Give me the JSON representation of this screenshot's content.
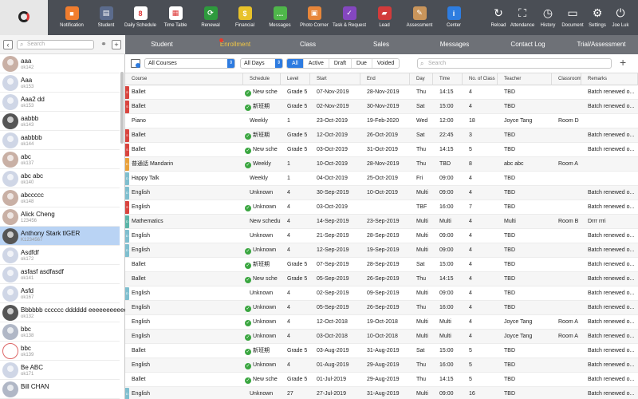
{
  "toolbar": [
    {
      "name": "notification",
      "label": "Notification",
      "color": "#f07d2e",
      "glyph": "■"
    },
    {
      "name": "student",
      "label": "Student",
      "color": "#5b6b8c",
      "glyph": "▤"
    },
    {
      "name": "daily-schedule",
      "label": "Daily Schedule",
      "color": "#ffffff",
      "glyph": "8"
    },
    {
      "name": "time-table",
      "label": "Time Table",
      "color": "#ffffff",
      "glyph": "▦"
    },
    {
      "name": "renewal",
      "label": "Renewal",
      "color": "#2e9a3d",
      "glyph": "⟳"
    },
    {
      "name": "financial",
      "label": "Financial",
      "color": "#e8c22a",
      "glyph": "$"
    },
    {
      "name": "messages",
      "label": "Messages",
      "color": "#4fb64a",
      "glyph": "…"
    },
    {
      "name": "photo-corner",
      "label": "Photo Corner",
      "color": "#e7863a",
      "glyph": "▣"
    },
    {
      "name": "task-request",
      "label": "Task & Request",
      "color": "#8447c0",
      "glyph": "✓"
    },
    {
      "name": "lead",
      "label": "Lead",
      "color": "#d23b3b",
      "glyph": "▰"
    },
    {
      "name": "assessment",
      "label": "Assessment",
      "color": "#c9955b",
      "glyph": "✎"
    },
    {
      "name": "center",
      "label": "Center",
      "color": "#2e7de0",
      "glyph": "i"
    },
    {
      "name": "reload",
      "label": "Reload",
      "color": "",
      "glyph": "↻"
    },
    {
      "name": "attendance",
      "label": "Attendance",
      "color": "",
      "glyph": "⛶"
    },
    {
      "name": "history",
      "label": "History",
      "color": "",
      "glyph": "◷"
    },
    {
      "name": "document",
      "label": "Document",
      "color": "",
      "glyph": "▭"
    },
    {
      "name": "settings",
      "label": "Settings",
      "color": "",
      "glyph": "⚙"
    },
    {
      "name": "user",
      "label": "Joe Luk",
      "color": "",
      "glyph": "⏻"
    }
  ],
  "left": {
    "search_placeholder": "Search",
    "students": [
      {
        "name": "aaa",
        "id": "ok142",
        "av": "p"
      },
      {
        "name": "Aaa",
        "id": "ok153",
        "av": ""
      },
      {
        "name": "Aaa2 dd",
        "id": "ok153",
        "av": ""
      },
      {
        "name": "aabbb",
        "id": "ok143",
        "av": "d"
      },
      {
        "name": "aabbbb",
        "id": "ok144",
        "av": ""
      },
      {
        "name": "abc",
        "id": "ok137",
        "av": "p"
      },
      {
        "name": "abc abc",
        "id": "ok140",
        "av": ""
      },
      {
        "name": "abccccc",
        "id": "ok148",
        "av": "p"
      },
      {
        "name": "Alick Cheng",
        "id": "123456",
        "av": "p"
      },
      {
        "name": "Anthony Stark tIGER",
        "id": "K1234567",
        "av": "d",
        "selected": true
      },
      {
        "name": "Asdfdf",
        "id": "ok172",
        "av": ""
      },
      {
        "name": "asfasf asdfasdf",
        "id": "ok141",
        "av": ""
      },
      {
        "name": "Asfd",
        "id": "ok167",
        "av": ""
      },
      {
        "name": "Bbbbbb cccccc dddddd eeeeeeeeeee",
        "id": "ok132",
        "av": "d"
      },
      {
        "name": "bbc",
        "id": "ok138",
        "av": "g"
      },
      {
        "name": "bbc",
        "id": "ok139",
        "av": "r"
      },
      {
        "name": "Be ABC",
        "id": "ok171",
        "av": ""
      },
      {
        "name": "Bill CHAN",
        "id": "",
        "av": "g"
      }
    ]
  },
  "tabs": [
    {
      "label": "Student",
      "active": false
    },
    {
      "label": "Enrollment",
      "active": true
    },
    {
      "label": "Class",
      "active": false
    },
    {
      "label": "Sales",
      "active": false
    },
    {
      "label": "Messages",
      "active": false
    },
    {
      "label": "Contact Log",
      "active": false
    },
    {
      "label": "Trial/Assessment",
      "active": false
    }
  ],
  "filters": {
    "courses": "All Courses",
    "days": "All Days",
    "segments": [
      "All",
      "Active",
      "Draft",
      "Due",
      "Voided"
    ],
    "active_segment": "All",
    "search_placeholder": "Search"
  },
  "table": {
    "columns": [
      "Course",
      "Schedule",
      "Level",
      "Start",
      "End",
      "Day",
      "Time",
      "No. of Class",
      "Teacher",
      "Classroom",
      "Remarks"
    ],
    "rows": [
      {
        "tag": "#d9453f",
        "tagtext": "S",
        "course": "Ballet",
        "schedule": "New sche",
        "chk": true,
        "level": "Grade 5",
        "start": "07-Nov-2019",
        "end": "28-Nov-2019",
        "day": "Thu",
        "time": "14:15",
        "n": "4",
        "teacher": "TBD",
        "room": "",
        "remarks": "Batch renewed o..."
      },
      {
        "tag": "#d9453f",
        "tagtext": "S",
        "course": "Ballet",
        "schedule": "新班期",
        "chk": true,
        "level": "Grade 5",
        "start": "02-Nov-2019",
        "end": "30-Nov-2019",
        "day": "Sat",
        "time": "15:00",
        "n": "4",
        "teacher": "TBD",
        "room": "",
        "remarks": "Batch renewed o..."
      },
      {
        "tag": "",
        "tagtext": "",
        "course": "Piano",
        "schedule": "Weekly",
        "chk": false,
        "level": "1",
        "start": "23-Oct-2019",
        "end": "19-Feb-2020",
        "day": "Wed",
        "time": "12:00",
        "n": "18",
        "teacher": "Joyce Tang",
        "room": "Room D",
        "remarks": ""
      },
      {
        "tag": "#d9453f",
        "tagtext": "S",
        "course": "Ballet",
        "schedule": "新班期",
        "chk": true,
        "level": "Grade 5",
        "start": "12-Oct-2019",
        "end": "26-Oct-2019",
        "day": "Sat",
        "time": "22:45",
        "n": "3",
        "teacher": "TBD",
        "room": "",
        "remarks": "Batch renewed o..."
      },
      {
        "tag": "#d9453f",
        "tagtext": "S",
        "course": "Ballet",
        "schedule": "New sche",
        "chk": true,
        "level": "Grade 5",
        "start": "03-Oct-2019",
        "end": "31-Oct-2019",
        "day": "Thu",
        "time": "14:15",
        "n": "5",
        "teacher": "TBD",
        "room": "",
        "remarks": "Batch renewed o..."
      },
      {
        "tag": "#e9a13b",
        "tagtext": "D",
        "course": "普通話 Mandarin",
        "schedule": "Weekly",
        "chk": true,
        "level": "1",
        "start": "10-Oct-2019",
        "end": "28-Nov-2019",
        "day": "Thu",
        "time": "TBD",
        "n": "8",
        "teacher": "abc abc",
        "room": "Room A",
        "remarks": ""
      },
      {
        "tag": "#7fbfcf",
        "tagtext": "D",
        "course": "Happy Talk",
        "schedule": "Weekly",
        "chk": false,
        "level": "1",
        "start": "04-Oct-2019",
        "end": "25-Oct-2019",
        "day": "Fri",
        "time": "09:00",
        "n": "4",
        "teacher": "TBD",
        "room": "",
        "remarks": ""
      },
      {
        "tag": "#7fbfcf",
        "tagtext": "D",
        "course": "English",
        "schedule": "Unknown",
        "chk": false,
        "level": "4",
        "start": "30-Sep-2019",
        "end": "10-Oct-2019",
        "day": "Multi",
        "time": "09:00",
        "n": "4",
        "teacher": "TBD",
        "room": "",
        "remarks": "Batch renewed o..."
      },
      {
        "tag": "#d9453f",
        "tagtext": "S",
        "course": "English",
        "schedule": "Unknown",
        "chk": true,
        "level": "4",
        "start": "03-Oct-2019",
        "end": "",
        "day": "TBF",
        "time": "16:00",
        "n": "7",
        "teacher": "TBD",
        "room": "",
        "remarks": "Batch renewed o..."
      },
      {
        "tag": "#5bb5a8",
        "tagtext": "D",
        "course": "Mathematics",
        "schedule": "New schedul",
        "chk": false,
        "level": "4",
        "start": "14-Sep-2019",
        "end": "23-Sep-2019",
        "day": "Multi",
        "time": "Multi",
        "n": "4",
        "teacher": "Multi",
        "room": "Room B",
        "remarks": "Drrr rrri"
      },
      {
        "tag": "#7fbfcf",
        "tagtext": "D",
        "course": "English",
        "schedule": "Unknown",
        "chk": false,
        "level": "4",
        "start": "21-Sep-2019",
        "end": "28-Sep-2019",
        "day": "Multi",
        "time": "09:00",
        "n": "4",
        "teacher": "TBD",
        "room": "",
        "remarks": "Batch renewed o..."
      },
      {
        "tag": "#7fbfcf",
        "tagtext": "D",
        "course": "English",
        "schedule": "Unknown",
        "chk": true,
        "level": "4",
        "start": "12-Sep-2019",
        "end": "19-Sep-2019",
        "day": "Multi",
        "time": "09:00",
        "n": "4",
        "teacher": "TBD",
        "room": "",
        "remarks": "Batch renewed o..."
      },
      {
        "tag": "",
        "tagtext": "",
        "course": "Ballet",
        "schedule": "新班期",
        "chk": true,
        "level": "Grade 5",
        "start": "07-Sep-2019",
        "end": "28-Sep-2019",
        "day": "Sat",
        "time": "15:00",
        "n": "4",
        "teacher": "TBD",
        "room": "",
        "remarks": "Batch renewed o..."
      },
      {
        "tag": "",
        "tagtext": "",
        "course": "Ballet",
        "schedule": "New sche",
        "chk": true,
        "level": "Grade 5",
        "start": "05-Sep-2019",
        "end": "26-Sep-2019",
        "day": "Thu",
        "time": "14:15",
        "n": "4",
        "teacher": "TBD",
        "room": "",
        "remarks": "Batch renewed o..."
      },
      {
        "tag": "#7fbfcf",
        "tagtext": "D",
        "course": "English",
        "schedule": "Unknown",
        "chk": false,
        "level": "4",
        "start": "02-Sep-2019",
        "end": "09-Sep-2019",
        "day": "Multi",
        "time": "09:00",
        "n": "4",
        "teacher": "TBD",
        "room": "",
        "remarks": "Batch renewed o..."
      },
      {
        "tag": "",
        "tagtext": "",
        "course": "English",
        "schedule": "Unknown",
        "chk": true,
        "level": "4",
        "start": "05-Sep-2019",
        "end": "26-Sep-2019",
        "day": "Thu",
        "time": "16:00",
        "n": "4",
        "teacher": "TBD",
        "room": "",
        "remarks": "Batch renewed o..."
      },
      {
        "tag": "",
        "tagtext": "",
        "course": "English",
        "schedule": "Unknown",
        "chk": true,
        "level": "4",
        "start": "12-Oct-2018",
        "end": "19-Oct-2018",
        "day": "Multi",
        "time": "Multi",
        "n": "4",
        "teacher": "Joyce Tang",
        "room": "Room A",
        "remarks": "Batch renewed o..."
      },
      {
        "tag": "",
        "tagtext": "",
        "course": "English",
        "schedule": "Unknown",
        "chk": true,
        "level": "4",
        "start": "03-Oct-2018",
        "end": "10-Oct-2018",
        "day": "Multi",
        "time": "Multi",
        "n": "4",
        "teacher": "Joyce Tang",
        "room": "Room A",
        "remarks": "Batch renewed o..."
      },
      {
        "tag": "",
        "tagtext": "",
        "course": "Ballet",
        "schedule": "新班期",
        "chk": true,
        "level": "Grade 5",
        "start": "03-Aug-2019",
        "end": "31-Aug-2019",
        "day": "Sat",
        "time": "15:00",
        "n": "5",
        "teacher": "TBD",
        "room": "",
        "remarks": "Batch renewed o..."
      },
      {
        "tag": "",
        "tagtext": "",
        "course": "English",
        "schedule": "Unknown",
        "chk": true,
        "level": "4",
        "start": "01-Aug-2019",
        "end": "29-Aug-2019",
        "day": "Thu",
        "time": "16:00",
        "n": "5",
        "teacher": "TBD",
        "room": "",
        "remarks": "Batch renewed o..."
      },
      {
        "tag": "",
        "tagtext": "",
        "course": "Ballet",
        "schedule": "New sche",
        "chk": true,
        "level": "Grade 5",
        "start": "01-Jul-2019",
        "end": "29-Aug-2019",
        "day": "Thu",
        "time": "14:15",
        "n": "5",
        "teacher": "TBD",
        "room": "",
        "remarks": "Batch renewed o..."
      },
      {
        "tag": "#7fbfcf",
        "tagtext": "D",
        "course": "English",
        "schedule": "Unknown",
        "chk": false,
        "level": "27",
        "start": "27-Jul-2019",
        "end": "31-Aug-2019",
        "day": "Multi",
        "time": "09:00",
        "n": "16",
        "teacher": "TBD",
        "room": "",
        "remarks": "Batch renewed o..."
      }
    ]
  }
}
